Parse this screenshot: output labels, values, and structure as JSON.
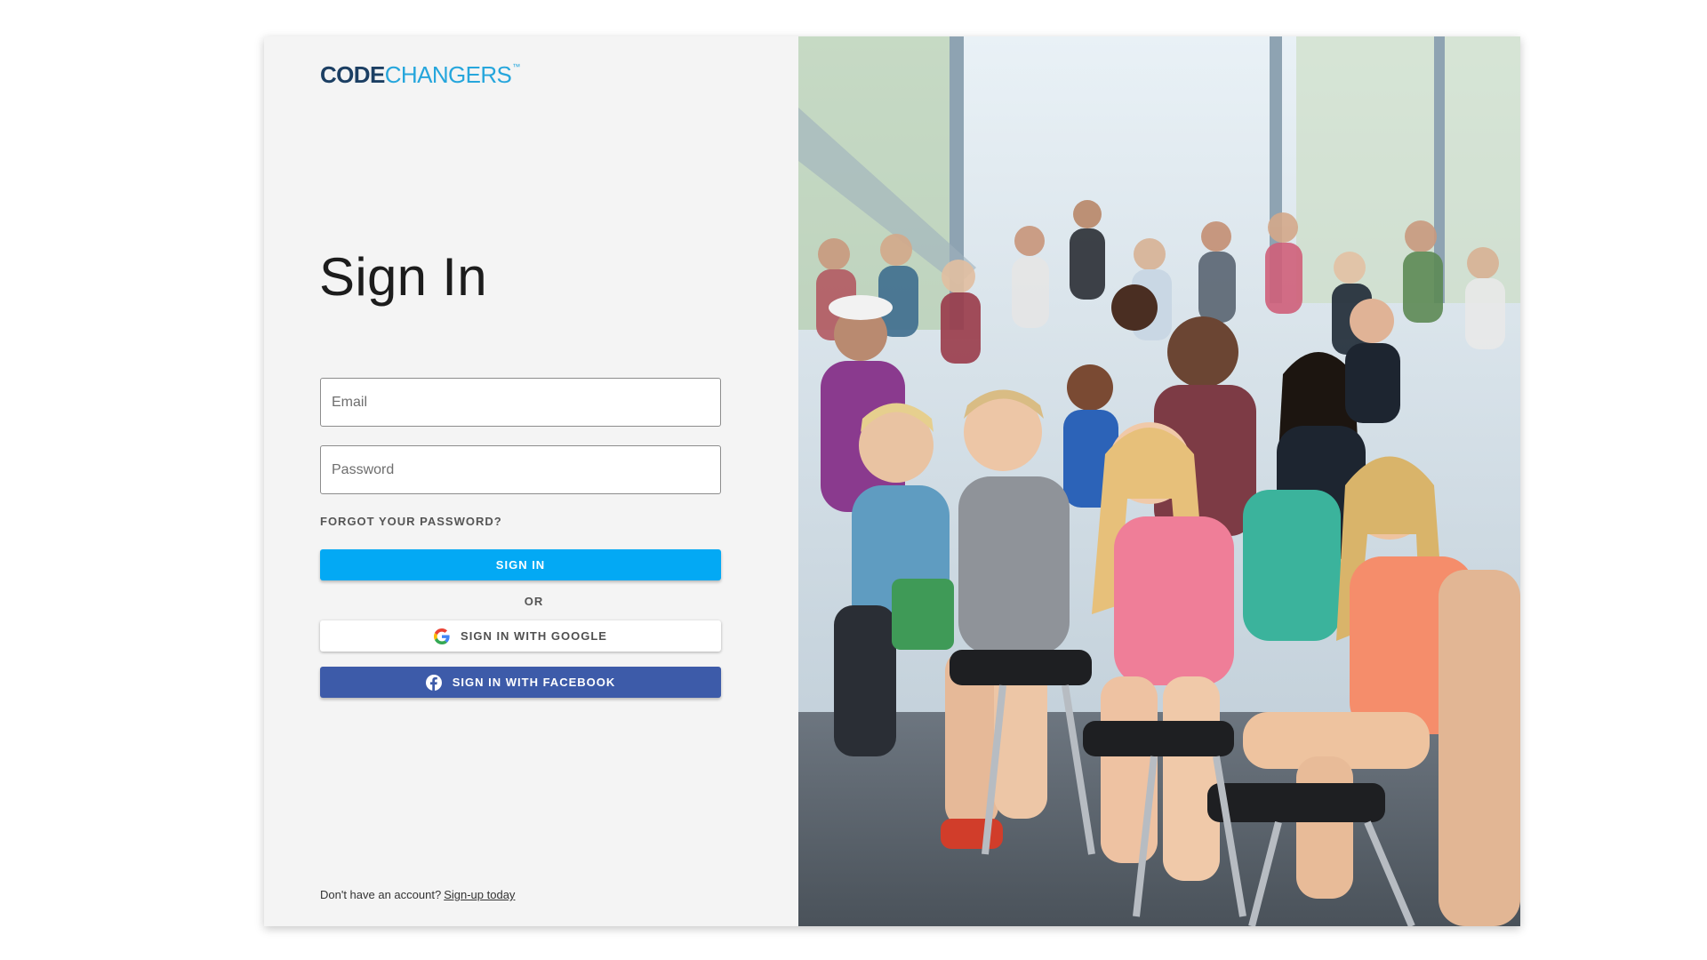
{
  "brand": {
    "logo_part1": "CODE",
    "logo_part2": "CHANGERS",
    "trademark": "™",
    "primary_color": "#1c3f63",
    "accent_color": "#26a6dc"
  },
  "signin": {
    "title": "Sign In",
    "email_placeholder": "Email",
    "password_placeholder": "Password",
    "forgot_label": "FORGOT YOUR PASSWORD?",
    "signin_label": "SIGN IN",
    "or_label": "OR",
    "google_label": "SIGN IN WITH GOOGLE",
    "facebook_label": "SIGN IN WITH FACEBOOK"
  },
  "footer": {
    "prompt": "Don't have an account?",
    "signup_label": "Sign-up today"
  },
  "colors": {
    "signin_button": "#03a9f4",
    "facebook_button": "#3d5ba9",
    "google_button": "#ffffff",
    "panel_background": "#f4f4f4"
  },
  "icons": {
    "google": "google-g-icon",
    "facebook": "facebook-f-icon"
  },
  "photo": {
    "subject": "children and adults seated in a bright room watching a presentation"
  }
}
